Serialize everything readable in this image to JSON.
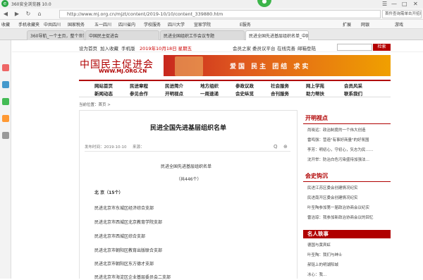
{
  "browser": {
    "title": "360安全浏览器 10.0",
    "url": "http://www.mj.org.cn/mjzt/content/2019-10/10/content_339880.htm",
    "search_box": "首件查询需单击开招印",
    "bookmarks": [
      "收藏",
      "手机收藏夹",
      "中共四川",
      "国家税务",
      "五一四川",
      "四川省内",
      "学校服务",
      "四川大学",
      "宣家学院",
      "E服务"
    ],
    "bookmarks_right": [
      "扩展",
      "网银",
      "游戏"
    ],
    "tabs": [
      "360导航_一个主页，整个世界",
      "中国民主促进会",
      "民进全国组织工作会议专题",
      "民进全国先进基层组织名单_中国"
    ],
    "logo_glyph": "e",
    "green_glyph": "●",
    "win_controls": [
      "☰",
      "—",
      "□",
      "✕"
    ],
    "nav_buttons": [
      "◀",
      "▶",
      "↻",
      "⌂"
    ]
  },
  "site": {
    "top_links": [
      "设为首页",
      "加入收藏",
      "手机版"
    ],
    "date": "2019年10月18日 星期五",
    "right_links": [
      "会员之家",
      "委员议平台",
      "在线完善",
      "邮箱登陆"
    ],
    "search_button": "检索",
    "logo_cn": "中国民主促进会",
    "logo_url": "WWW.MJ.ORG.CN",
    "banner_slogan": "爱国 民主 团结 求实",
    "nav_row1": [
      "网站首页",
      "民进章程",
      "民进简介",
      "地方组织",
      "参政议政",
      "社会服务",
      "网上学苑",
      "会员风采"
    ],
    "nav_row2": [
      "新闻动态",
      "参见合作",
      "开明视点",
      "一周速递",
      "会史纵览",
      "合刊服务",
      "助力帮扶",
      "联系我们"
    ],
    "nav_row1b": [
      "",
      "",
      "",
      "",
      "",
      "",
      "",
      ""
    ],
    "breadcrumb": "当前位置：首页 >",
    "mid_row2_extra": [
      "会史纵览"
    ]
  },
  "article": {
    "title": "民进全国先进基层组织名单",
    "publish_time": "发布时间：2019-10-10",
    "source": "来源：",
    "search_icon_label": "Q",
    "zoom_label": "⊕",
    "intro": "民进全国先进基层组织名单",
    "count": "（共446个）",
    "section": "北 京（15个）",
    "items": [
      "民进北京市东城区经济综合支部",
      "民进北京市西城区北京教育学院支部",
      "民进北京市西城区综合支部",
      "民进北京市朝阳区教育出版联合支部",
      "民进北京市朝阳区东方德才支部",
      "民进北京市海淀区企业基层委员会二支部"
    ]
  },
  "right": {
    "section1": "开明视点",
    "section1_items": [
      "尚晓远：政治制度的一个伟大创造",
      "雷鸣强：营造\"有事好商量\"的好氛围",
      "李芳：明初心，守初心，矢志为民……",
      "沈开举：防治白色污染盛待加强法…"
    ],
    "section2": "会史钩沉",
    "section2_items": [
      "民进江苏区委会创建情况纪实",
      "民进南开区委会创建情况纪实",
      "叶圣陶参加第一届政治协商会议纪实",
      "雷洁琼：我参加新政治协商会议的回忆"
    ],
    "section3": "名人轶事",
    "section3_items": [
      "德国与黄宾虹",
      "叶圣陶：我们与绅士",
      "郝铭上的明湖阳城",
      "冰心：我…"
    ]
  }
}
